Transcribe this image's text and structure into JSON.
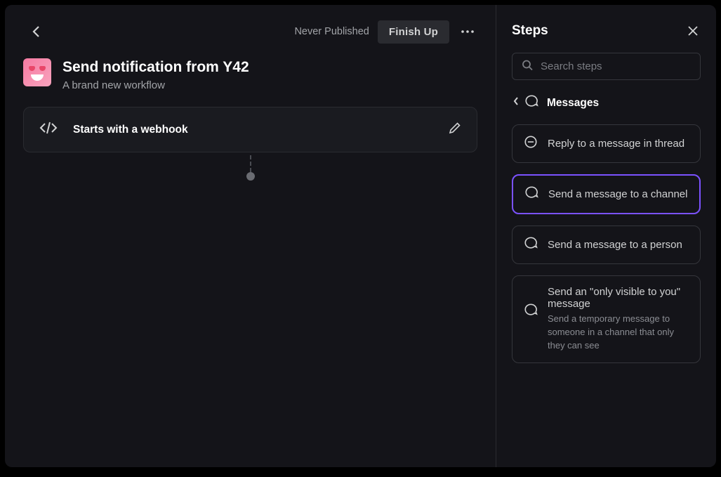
{
  "topbar": {
    "status": "Never Published",
    "finish_label": "Finish Up"
  },
  "workflow": {
    "title": "Send notification from Y42",
    "subtitle": "A brand new workflow"
  },
  "step": {
    "label": "Starts with a webhook"
  },
  "sidebar": {
    "title": "Steps",
    "search_placeholder": "Search steps",
    "breadcrumb_label": "Messages",
    "options": [
      {
        "label": "Reply to a message in thread",
        "desc": null,
        "selected": false,
        "icon": "reply"
      },
      {
        "label": "Send a message to a channel",
        "desc": null,
        "selected": true,
        "icon": "message"
      },
      {
        "label": "Send a message to a person",
        "desc": null,
        "selected": false,
        "icon": "message"
      },
      {
        "label": "Send an \"only visible to you\" message",
        "desc": "Send a temporary message to someone in a channel that only they can see",
        "selected": false,
        "icon": "message"
      }
    ]
  }
}
